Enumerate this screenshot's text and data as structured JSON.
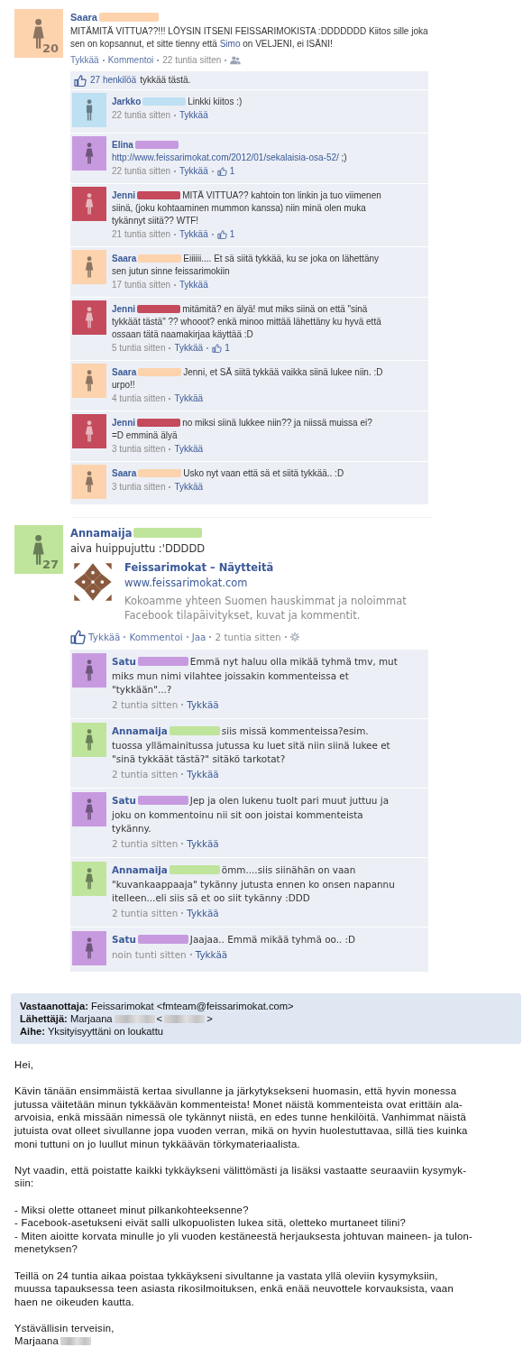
{
  "posts": [
    {
      "kind": "compact",
      "author": "Saara",
      "color": "#fdd3ae",
      "avatar": {
        "kind": "female",
        "badge": "20"
      },
      "text_parts": [
        {
          "kind": "text",
          "text": "MITÄMITÄ VITTUA??!!! LÖYSIN ITSENI FEISSARIMOKISTA :DDDDDDD Kiitos sille joka sen on kopsannut, et sitte tienny että "
        },
        {
          "kind": "link",
          "text": "Simo"
        },
        {
          "kind": "text",
          "text": " on VELJENI, ei ISÄNI!"
        }
      ],
      "actions": [
        {
          "kind": "link",
          "label": "Tykkää"
        },
        {
          "kind": "link",
          "label": "Kommentoi"
        },
        {
          "kind": "time",
          "label": "22 tuntia sitten"
        },
        {
          "kind": "audience"
        }
      ],
      "likes": {
        "count_link": "27 henkilöä",
        "text": "tykkää tästä."
      },
      "comments": [
        {
          "author": "Jarkko",
          "color": "#bde0f2",
          "kind": "male",
          "text": "Linkki kiitos :)",
          "time": "22 tuntia sitten",
          "action": "Tykkää"
        },
        {
          "author": "Elina",
          "color": "#c79ae0",
          "kind": "female",
          "link": "http://www.feissarimokat.com/2012/01/sekalaisia-osa-52/",
          "text": " ;)",
          "time": "22 tuntia sitten",
          "action": "Tykkää",
          "like_count": "1"
        },
        {
          "author": "Jenni",
          "color": "#c44a5c",
          "kind": "female",
          "text": "MITÄ VITTUA?? kahtoin ton linkin ja tuo viimenen siinä, (joku kohtaaminen mummon kanssa) niin minä olen muka tykännyt siitä?? WTF!",
          "time": "21 tuntia sitten",
          "action": "Tykkää",
          "like_count": "1"
        },
        {
          "author": "Saara",
          "color": "#fdd3ae",
          "kind": "female",
          "text": "Eiiiiii.... Et sä siitä tykkää, ku se joka on lähettäny sen jutun sinne feissarimokiin",
          "time": "17 tuntia sitten",
          "action": "Tykkää"
        },
        {
          "author": "Jenni",
          "color": "#c44a5c",
          "kind": "female",
          "text": "mitämitä? en älyä! mut miks siinä on että \"sinä tykkäät tästä\" ?? whooot? enkä minoo mittää lähettäny ku hyvä että ossaan tätä naamakirjaa käyttää :D",
          "time": "5 tuntia sitten",
          "action": "Tykkää",
          "like_count": "1"
        },
        {
          "author": "Saara",
          "color": "#fdd3ae",
          "kind": "female",
          "text": "Jenni, et SÄ siitä tykkää vaikka siinä lukee niin. :D urpo!!",
          "time": "4 tuntia sitten",
          "action": "Tykkää"
        },
        {
          "author": "Jenni",
          "color": "#c44a5c",
          "kind": "female",
          "text": "no miksi siinä lukkee niin?? ja niissä muissa ei? =D emminä älyä",
          "time": "3 tuntia sitten",
          "action": "Tykkää"
        },
        {
          "author": "Saara",
          "color": "#fdd3ae",
          "kind": "female",
          "text": "Usko nyt vaan että sä et siitä tykkää.. :D",
          "time": "3 tuntia sitten",
          "action": "Tykkää"
        }
      ]
    },
    {
      "kind": "wide",
      "author": "Annamaija",
      "color": "#bfe49c",
      "avatar": {
        "kind": "female",
        "badge": "27"
      },
      "text_parts": [
        {
          "kind": "text",
          "text": "aiva huippujuttu :'DDDDD"
        }
      ],
      "attachment": {
        "title": "Feissarimokat – Näytteitä",
        "url": "www.feissarimokat.com",
        "description": "Kokoamme yhteen Suomen hauskimmat ja noloimmat Facebook tilapäivitykset, kuvat ja kommentit."
      },
      "actions": [
        {
          "kind": "like"
        },
        {
          "kind": "link",
          "label": "Tykkää"
        },
        {
          "kind": "link",
          "label": "Kommentoi"
        },
        {
          "kind": "link",
          "label": "Jaa"
        },
        {
          "kind": "time",
          "label": "2 tuntia sitten"
        },
        {
          "kind": "gear"
        }
      ],
      "comments": [
        {
          "author": "Satu",
          "color": "#c79ae0",
          "kind": "female",
          "text": "Emmä nyt haluu olla mikää tyhmä tmv, mut miks mun nimi vilahtee joissakin kommenteissa et \"tykkään\"...?",
          "time": "2 tuntia sitten",
          "action": "Tykkää"
        },
        {
          "author": "Annamaija",
          "color": "#bfe49c",
          "kind": "female",
          "text": "siis missä kommenteissa?esim. tuossa yllämainitussa jutussa ku luet sitä niin siinä lukee et \"sinä tykkäät tästä?\" sitäkö tarkotat?",
          "time": "2 tuntia sitten",
          "action": "Tykkää"
        },
        {
          "author": "Satu",
          "color": "#c79ae0",
          "kind": "female",
          "text": "Jep ja olen lukenu tuolt pari muut juttuu ja joku on kommentoinu nii sit oon joistai kommenteista tykänny.",
          "time": "2 tuntia sitten",
          "action": "Tykkää"
        },
        {
          "author": "Annamaija",
          "color": "#bfe49c",
          "kind": "female",
          "text": "ömm....siis siinähän on vaan \"kuvankaappaaja\" tykänny jutusta ennen ko onsen napannu itelleen...eli siis sä et oo siit tykänny :DDD",
          "time": "2 tuntia sitten",
          "action": "Tykkää"
        },
        {
          "author": "Satu",
          "color": "#c79ae0",
          "kind": "female",
          "text": "Jaajaa.. Emmä mikää tyhmä oo.. :D",
          "time": "noin tunti sitten",
          "action": "Tykkää"
        }
      ]
    }
  ],
  "email": {
    "header": [
      {
        "label": "Vastaanottaja:",
        "parts": [
          {
            "kind": "text",
            "text": "Feissarimokat <fmteam@feissarimokat.com>"
          }
        ]
      },
      {
        "label": "Lähettäjä:",
        "parts": [
          {
            "kind": "text",
            "text": "Marjaana"
          },
          {
            "kind": "blur"
          },
          {
            "kind": "text",
            "text": "<"
          },
          {
            "kind": "blur"
          },
          {
            "kind": "text",
            "text": ">"
          }
        ]
      },
      {
        "label": "Aihe:",
        "parts": [
          {
            "kind": "text",
            "text": "Yksityisyyttäni on loukattu"
          }
        ]
      }
    ],
    "paragraphs": [
      "Hei,",
      "Kävin tänään ensimmäistä kertaa sivullanne ja järkytyksekseni huomasin, että hyvin monessa\njutussa väitetään minun tykkäävän kommenteista! Monet näistä kommenteista ovat erittäin ala-\narvoisia, enkä missään nimessä ole tykännyt niistä, en edes tunne henkilöitä. Vanhimmat näistä\njutuista ovat olleet sivullanne jopa vuoden verran, mikä on hyvin huolestuttavaa, sillä ties kuinka\nmoni tuttuni on jo luullut minun tykkäävän törkymateriaalista.",
      "Nyt vaadin, että poistatte kaikki tykkäykseni välittömästi ja lisäksi vastaatte seuraaviin kysymyk-\nsiin:",
      "- Miksi olette ottaneet minut pilkankohteeksenne?\n- Facebook-asetukseni eivät salli ulkopuolisten lukea sitä, oletteko murtaneet tilini?\n- Miten aioitte korvata minulle jo yli vuoden kestäneestä herjauksesta johtuvan maineen- ja tulon-\nmenetyksen?",
      "Teillä on 24 tuntia aikaa poistaa tykkäykseni sivultanne ja vastata yllä oleviin kysymyksiin,\nmuussa tapauksessa teen asiasta rikosilmoituksen, enkä enää neuvottele korvauksista, vaan\nhaen ne oikeuden kautta."
    ],
    "closing": "Ystävällisin terveisin,",
    "signature": "Marjaana",
    "signature_redacted": true
  }
}
